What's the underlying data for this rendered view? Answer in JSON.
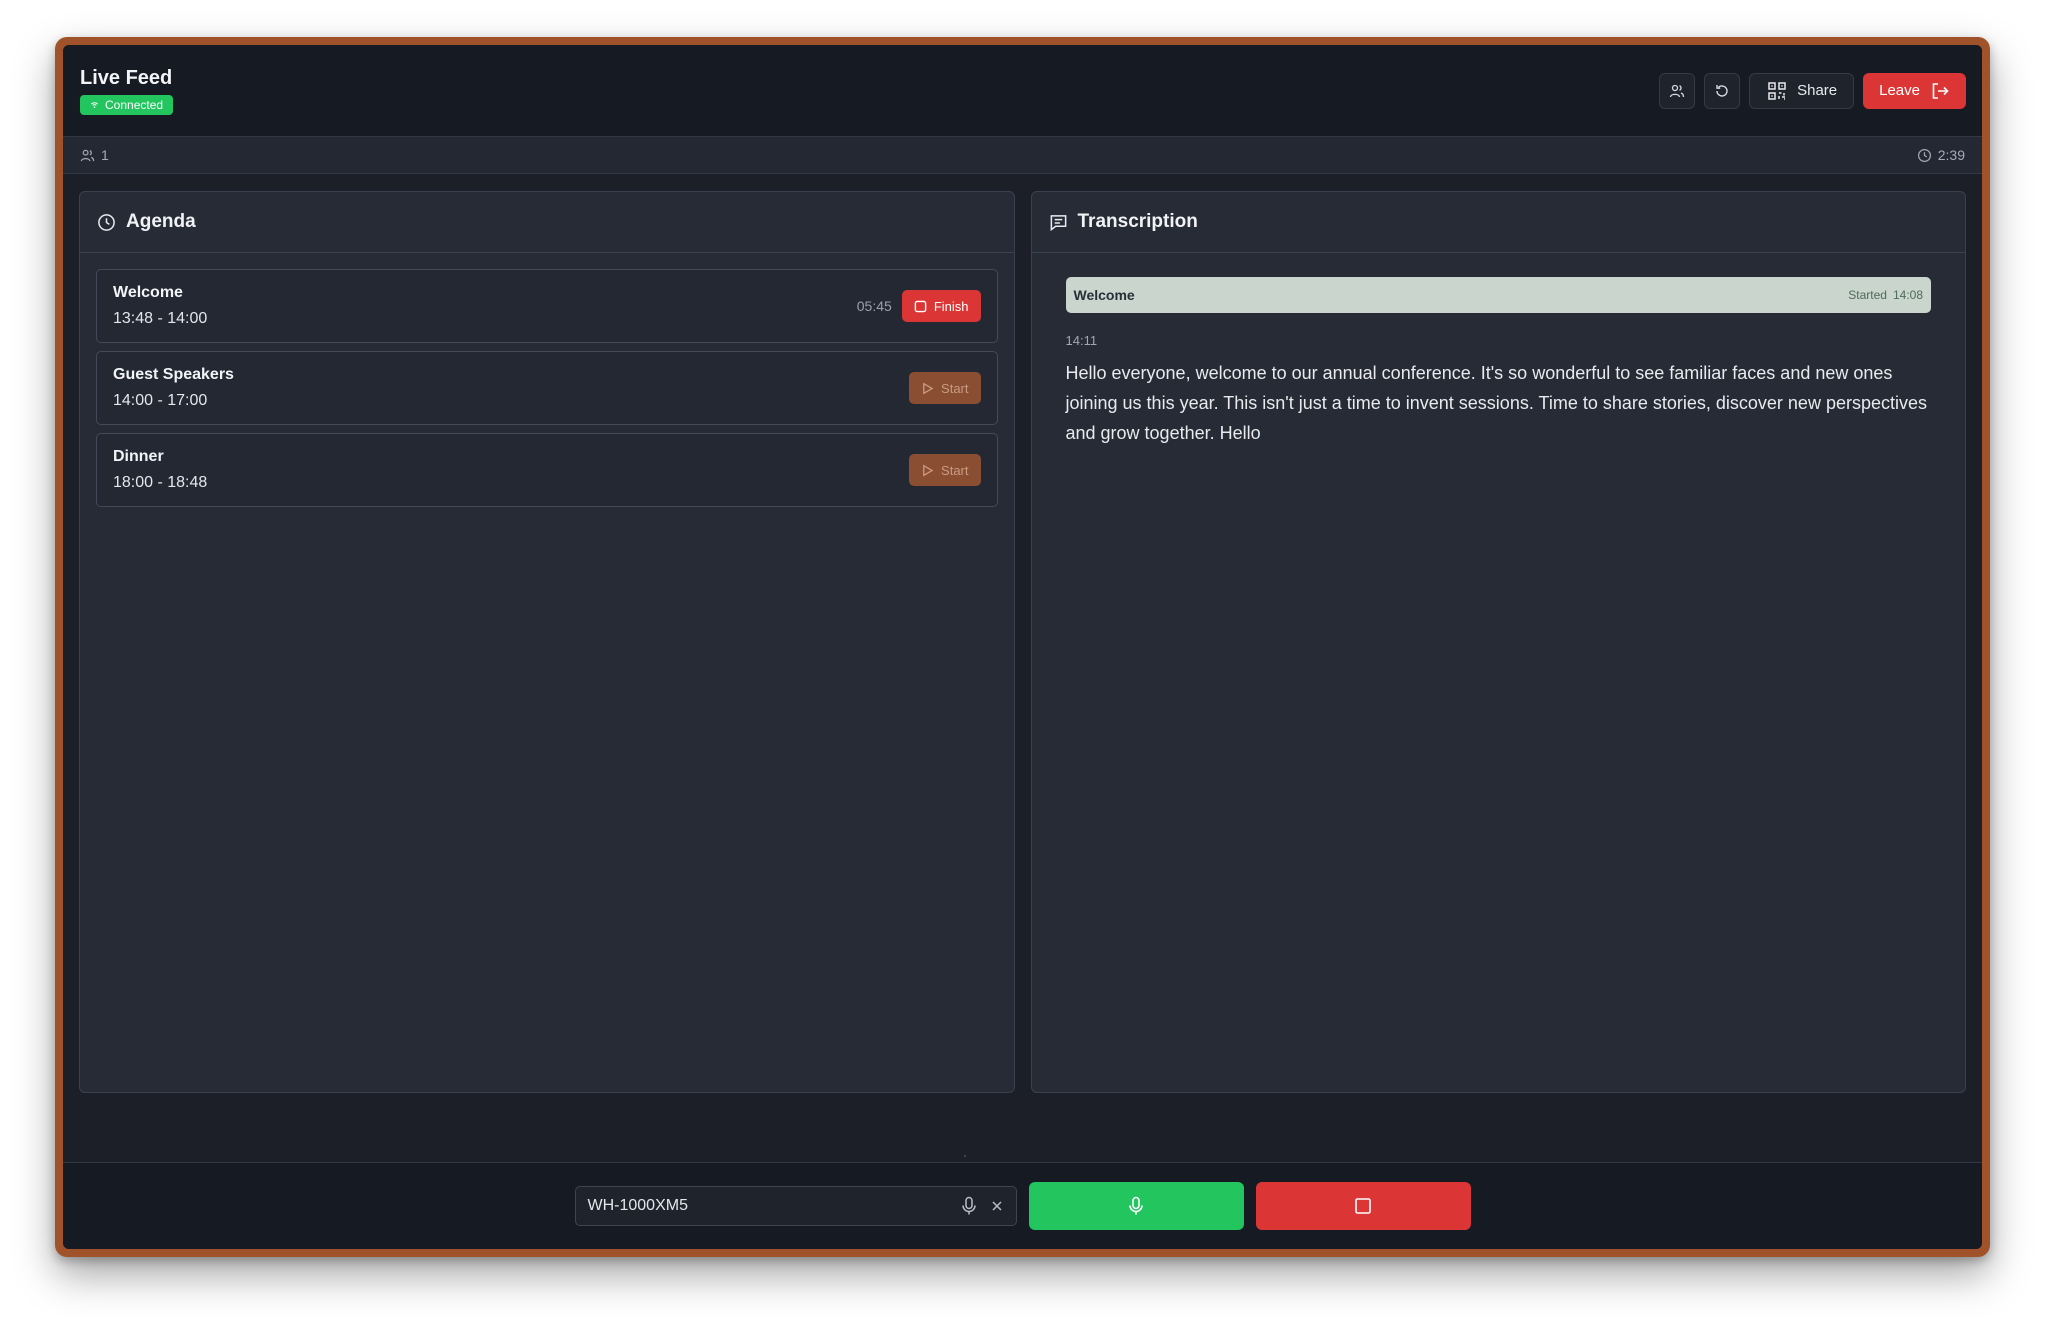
{
  "header": {
    "title": "Live Feed",
    "status": "Connected",
    "share_label": "Share",
    "leave_label": "Leave"
  },
  "subbar": {
    "participants": "1",
    "elapsed": "2:39"
  },
  "agenda": {
    "title": "Agenda",
    "items": [
      {
        "name": "Welcome",
        "time": "13:48 - 14:00",
        "elapsed": "05:45",
        "action": "Finish"
      },
      {
        "name": "Guest Speakers",
        "time": "14:00 - 17:00",
        "action": "Start"
      },
      {
        "name": "Dinner",
        "time": "18:00 - 18:48",
        "action": "Start"
      }
    ]
  },
  "transcription": {
    "title": "Transcription",
    "segment": {
      "title": "Welcome",
      "status": "Started",
      "time": "14:08"
    },
    "entry": {
      "time": "14:11",
      "text": "Hello everyone, welcome to our annual conference. It's so wonderful to see familiar faces and new ones joining us this year. This isn't just a time to invent sessions. Time to share stories, discover new perspectives and grow together. Hello"
    }
  },
  "controls": {
    "device": "WH-1000XM5"
  },
  "colors": {
    "accent_green": "#22c55e",
    "accent_red": "#dc3535",
    "frame_border": "#a0532a",
    "start_button": "#8a4e33"
  }
}
